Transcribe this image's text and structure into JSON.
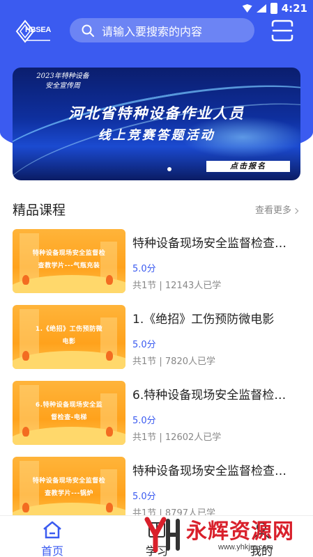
{
  "status_bar": {
    "time": "4:21"
  },
  "header": {
    "logo_text": "HBSEA",
    "search_placeholder": "请输入要搜索的内容"
  },
  "banner": {
    "tag_line1": "2023年特种设备",
    "tag_line2": "安全宣传周",
    "title_line1": "河北省特种设备作业人员",
    "title_line2": "线上竞赛答题活动",
    "cta": "点击报名"
  },
  "section": {
    "title": "精品课程",
    "more": "查看更多"
  },
  "courses": [
    {
      "thumb_line1": "特种设备现场安全监督检",
      "thumb_line2": "查教学片---气瓶充装",
      "title": "特种设备现场安全监督检查…",
      "score": "5.0分",
      "meta": "共1节 | 12143人已学"
    },
    {
      "thumb_line1": "1.《绝招》工伤预防微",
      "thumb_line2": "电影",
      "title": "1.《绝招》工伤预防微电影",
      "score": "5.0分",
      "meta": "共1节 | 7820人已学"
    },
    {
      "thumb_line1": "6.特种设备现场安全监",
      "thumb_line2": "督检查-电梯",
      "title": "6.特种设备现场安全监督检…",
      "score": "5.0分",
      "meta": "共1节 | 12602人已学"
    },
    {
      "thumb_line1": "特种设备现场安全监督检",
      "thumb_line2": "查教学片---锅炉",
      "title": "特种设备现场安全监督检查…",
      "score": "5.0分",
      "meta": "共1节 | 8797人已学"
    }
  ],
  "tabbar": {
    "home": "首页",
    "study": "学习",
    "mine": "我的"
  },
  "watermark": {
    "text": "永辉资源网",
    "url": "www.yhkjm.com"
  },
  "colors": {
    "primary": "#3b5bf0",
    "accent_orange": "#ffa21c",
    "watermark_red": "#d9202b"
  }
}
